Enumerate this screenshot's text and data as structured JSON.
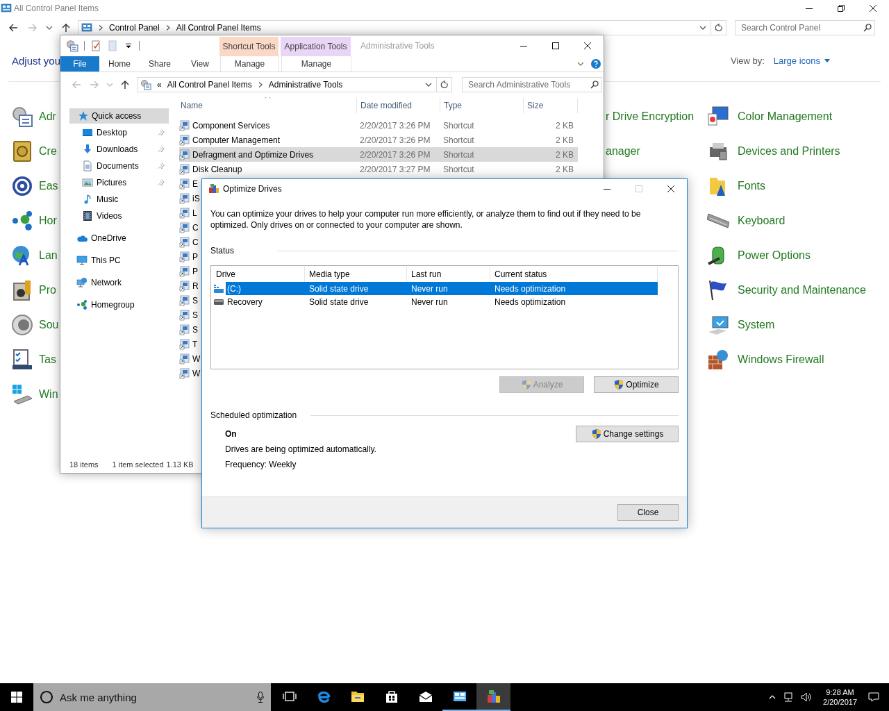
{
  "control_panel": {
    "title": "All Control Panel Items",
    "breadcrumb": [
      "Control Panel",
      "All Control Panel Items"
    ],
    "search_placeholder": "Search Control Panel",
    "heading": "Adjust you",
    "view_by": {
      "label": "View by:",
      "value": "Large icons"
    },
    "items_left": [
      "Adr",
      "Cre",
      "Eas",
      "Hor",
      "Lan",
      "Pro",
      "Sou",
      "Tas",
      "Win"
    ],
    "items_middle": [
      "r Drive Encryption",
      "anager"
    ],
    "items_right": [
      "Color Management",
      "Devices and Printers",
      "Fonts",
      "Keyboard",
      "Power Options",
      "Security and Maintenance",
      "System",
      "Windows Firewall"
    ]
  },
  "explorer": {
    "contextual_tabs": [
      {
        "group": "Shortcut Tools",
        "tab": "Manage",
        "color": "#f9d9c6"
      },
      {
        "group": "Application Tools",
        "tab": "Manage",
        "color": "#e9d5f6"
      }
    ],
    "title": "Administrative Tools",
    "ribbon_tabs": [
      {
        "label": "File",
        "kind": "file"
      },
      {
        "label": "Home",
        "kind": "tab"
      },
      {
        "label": "Share",
        "kind": "tab"
      },
      {
        "label": "View",
        "kind": "tab"
      }
    ],
    "breadcrumb_overflow": "«",
    "breadcrumb": [
      "All Control Panel Items",
      "Administrative Tools"
    ],
    "search_placeholder": "Search Administrative Tools",
    "nav": [
      {
        "label": "Quick access",
        "selected": true,
        "children": [
          {
            "label": "Desktop",
            "pinned": true,
            "selected": false
          },
          {
            "label": "Downloads",
            "pinned": true,
            "selected": false
          },
          {
            "label": "Documents",
            "pinned": true,
            "selected": false
          },
          {
            "label": "Pictures",
            "pinned": true,
            "selected": false
          },
          {
            "label": "Music",
            "pinned": false,
            "selected": false
          },
          {
            "label": "Videos",
            "pinned": false,
            "selected": false
          }
        ]
      },
      {
        "label": "OneDrive",
        "selected": false
      },
      {
        "label": "This PC",
        "selected": false
      },
      {
        "label": "Network",
        "selected": false
      },
      {
        "label": "Homegroup",
        "selected": false
      }
    ],
    "columns": [
      "Name",
      "Date modified",
      "Type",
      "Size"
    ],
    "files": [
      {
        "name": "Component Services",
        "date": "2/20/2017 3:26 PM",
        "type": "Shortcut",
        "size": "2 KB",
        "selected": false
      },
      {
        "name": "Computer Management",
        "date": "2/20/2017 3:26 PM",
        "type": "Shortcut",
        "size": "2 KB",
        "selected": false
      },
      {
        "name": "Defragment and Optimize Drives",
        "date": "2/20/2017 3:26 PM",
        "type": "Shortcut",
        "size": "2 KB",
        "selected": true
      },
      {
        "name": "Disk Cleanup",
        "date": "2/20/2017 3:27 PM",
        "type": "Shortcut",
        "size": "2 KB",
        "selected": false
      },
      {
        "name": "E",
        "selected": false
      },
      {
        "name": "iS",
        "selected": false
      },
      {
        "name": "L",
        "selected": false
      },
      {
        "name": "C",
        "selected": false
      },
      {
        "name": "C",
        "selected": false
      },
      {
        "name": "P",
        "selected": false
      },
      {
        "name": "P",
        "selected": false
      },
      {
        "name": "R",
        "selected": false
      },
      {
        "name": "S",
        "selected": false
      },
      {
        "name": "S",
        "selected": false
      },
      {
        "name": "S",
        "selected": false
      },
      {
        "name": "T",
        "selected": false
      },
      {
        "name": "W",
        "selected": false
      },
      {
        "name": "W",
        "selected": false
      }
    ],
    "status": {
      "count": "18 items",
      "selection": "1 item selected",
      "size": "1.13 KB"
    }
  },
  "dialog": {
    "title": "Optimize Drives",
    "description": "You can optimize your drives to help your computer run more efficiently, or analyze them to find out if they need to be optimized. Only drives on or connected to your computer are shown.",
    "status_label": "Status",
    "columns": [
      "Drive",
      "Media type",
      "Last run",
      "Current status"
    ],
    "drives": [
      {
        "drive": "(C:)",
        "media_type": "Solid state drive",
        "last_run": "Never run",
        "status": "Needs optimization",
        "selected": true
      },
      {
        "drive": "Recovery",
        "media_type": "Solid state drive",
        "last_run": "Never run",
        "status": "Needs optimization",
        "selected": false
      }
    ],
    "actions": [
      {
        "label": "Analyze",
        "disabled": true
      },
      {
        "label": "Optimize",
        "disabled": false
      }
    ],
    "schedule": {
      "label": "Scheduled optimization",
      "state": "On",
      "note": "Drives are being optimized automatically.",
      "frequency": "Frequency: Weekly",
      "button": "Change settings"
    },
    "close": "Close"
  },
  "taskbar": {
    "search_placeholder": "Ask me anything",
    "apps": [
      {
        "running": false,
        "selected": false
      },
      {
        "running": false,
        "selected": false
      },
      {
        "running": false,
        "selected": false
      },
      {
        "running": false,
        "selected": false
      },
      {
        "running": true,
        "selected": false
      },
      {
        "running": true,
        "selected": true
      }
    ],
    "time": "9:28 AM",
    "date": "2/20/2017"
  }
}
